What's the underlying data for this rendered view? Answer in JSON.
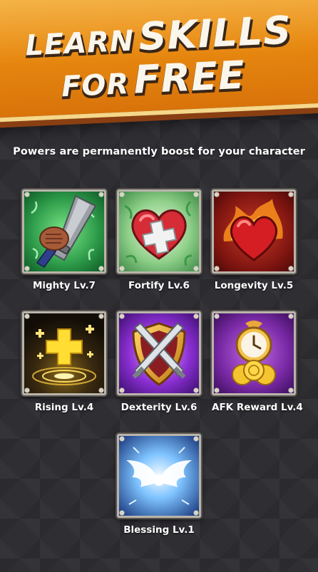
{
  "header": {
    "line1_small": "LEARN",
    "line1_large": "SKILLS",
    "line2_small": "FOR",
    "line2_large": "FREE"
  },
  "subtitle": "Powers are permanently boost for your character",
  "colors": {
    "banner_orange": "#e88a10",
    "banner_trim": "#f5d78a",
    "background": "#2f2e33",
    "frame": "#b9b4aa"
  },
  "skills": [
    {
      "name": "Mighty Lv.7",
      "icon": "sword-fist-icon"
    },
    {
      "name": "Fortify Lv.6",
      "icon": "heart-plus-icon"
    },
    {
      "name": "Longevity Lv.5",
      "icon": "flaming-heart-icon"
    },
    {
      "name": "Rising Lv.4",
      "icon": "golden-cross-icon"
    },
    {
      "name": "Dexterity Lv.6",
      "icon": "crossed-swords-shield-icon"
    },
    {
      "name": "AFK Reward Lv.4",
      "icon": "clock-coins-icon"
    },
    {
      "name": "Blessing Lv.1",
      "icon": "angel-wings-icon"
    }
  ]
}
